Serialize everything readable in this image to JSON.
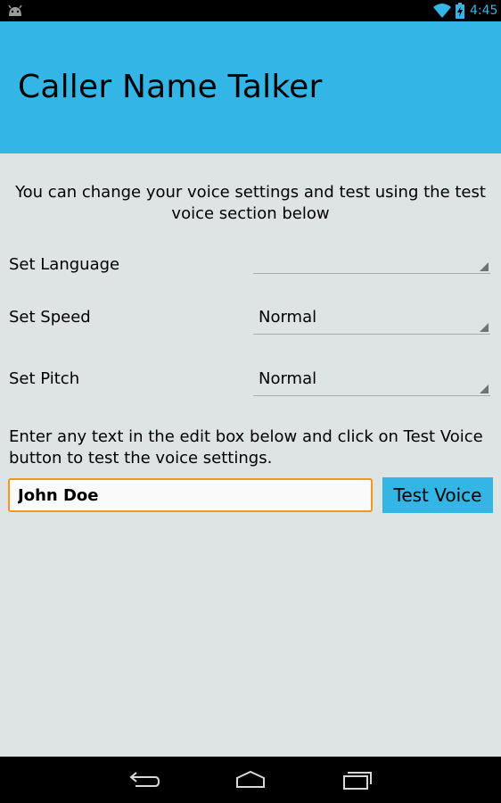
{
  "status_bar": {
    "time": "4:45",
    "icons": [
      "android-icon",
      "wifi-icon",
      "battery-icon"
    ],
    "accent_color": "#33b5e5"
  },
  "action_bar": {
    "title": "Caller Name Talker",
    "color": "#33b5e5"
  },
  "intro": {
    "text": "You can change your voice settings and test using the test voice section below"
  },
  "settings": {
    "language": {
      "label": "Set Language",
      "value": ""
    },
    "speed": {
      "label": "Set Speed",
      "value": "Normal"
    },
    "pitch": {
      "label": "Set Pitch",
      "value": "Normal"
    }
  },
  "test_section": {
    "instructions": "Enter any text in the edit box below and click on Test Voice button to test the voice settings.",
    "input_value": "John Doe",
    "button_label": "Test Voice",
    "input_border_color": "#f2961e"
  },
  "nav_bar": {
    "icons": [
      "back-icon",
      "home-icon",
      "recent-apps-icon"
    ]
  }
}
